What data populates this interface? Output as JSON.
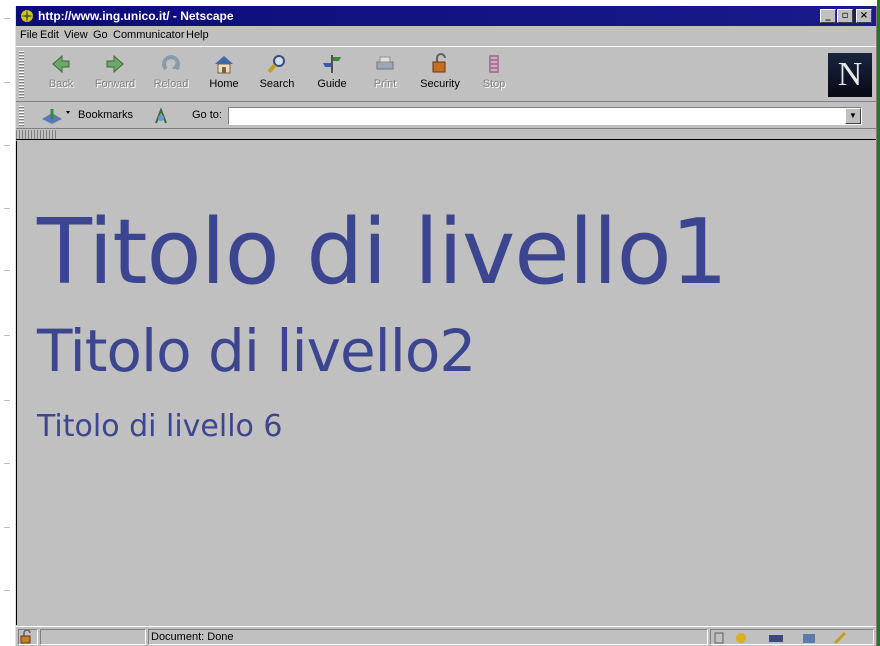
{
  "window": {
    "title": "http://www.ing.unico.it/ - Netscape",
    "controls": {
      "minimize": "_",
      "maximize": "▫",
      "close": "×"
    }
  },
  "menu": [
    "File",
    "Edit",
    "View",
    "Go",
    "Communicator",
    "Help"
  ],
  "toolbar": {
    "buttons": [
      {
        "label": "Back",
        "icon": "back-arrow-icon",
        "enabled": false
      },
      {
        "label": "Forward",
        "icon": "forward-arrow-icon",
        "enabled": false
      },
      {
        "label": "Reload",
        "icon": "reload-icon",
        "enabled": false
      },
      {
        "label": "Home",
        "icon": "home-icon",
        "enabled": true
      },
      {
        "label": "Search",
        "icon": "search-icon",
        "enabled": true
      },
      {
        "label": "Guide",
        "icon": "guide-icon",
        "enabled": true
      },
      {
        "label": "Print",
        "icon": "print-icon",
        "enabled": false
      },
      {
        "label": "Security",
        "icon": "lock-icon",
        "enabled": true
      },
      {
        "label": "Stop",
        "icon": "stop-icon",
        "enabled": false
      }
    ],
    "logo": "N"
  },
  "location": {
    "bookmarks_label": "Bookmarks",
    "goto_label": "Go to:",
    "url_value": ""
  },
  "content": {
    "h1": "Titolo di livello1",
    "h2": "Titolo di livello2",
    "h6": "Titolo di livello 6",
    "heading_color": "#3c4690"
  },
  "status": {
    "text": "Document: Done"
  }
}
